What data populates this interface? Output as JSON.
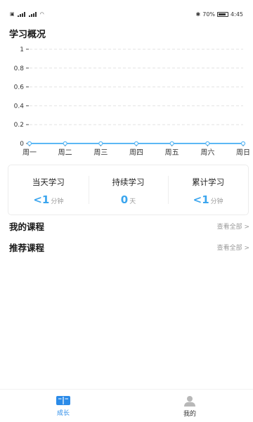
{
  "status_bar": {
    "left_text": "4G 4G",
    "battery_percent": "70%",
    "time": "4:45"
  },
  "page_title": "学习概况",
  "chart_data": {
    "type": "line",
    "categories": [
      "周一",
      "周二",
      "周三",
      "周四",
      "周五",
      "周六",
      "周日"
    ],
    "values": [
      0,
      0,
      0,
      0,
      0,
      0,
      0
    ],
    "y_ticks": [
      "0",
      "0.2",
      "0.4",
      "0.6",
      "0.8",
      "1"
    ],
    "ylim": [
      0,
      1
    ],
    "grid": true,
    "line_color": "#5cb8f5"
  },
  "stats": [
    {
      "label": "当天学习",
      "value": "<1",
      "unit": "分钟"
    },
    {
      "label": "持续学习",
      "value": "0",
      "unit": "天"
    },
    {
      "label": "累计学习",
      "value": "<1",
      "unit": "分钟"
    }
  ],
  "my_courses": {
    "title": "我的课程",
    "link": "查看全部 >"
  },
  "recommended": {
    "title": "推荐课程",
    "link": "查看全部 >"
  },
  "tabbar": {
    "items": [
      {
        "label": "成长",
        "icon": "book-icon",
        "active": true
      },
      {
        "label": "我的",
        "icon": "person-icon",
        "active": false
      }
    ],
    "active_color": "#2b8be8"
  }
}
